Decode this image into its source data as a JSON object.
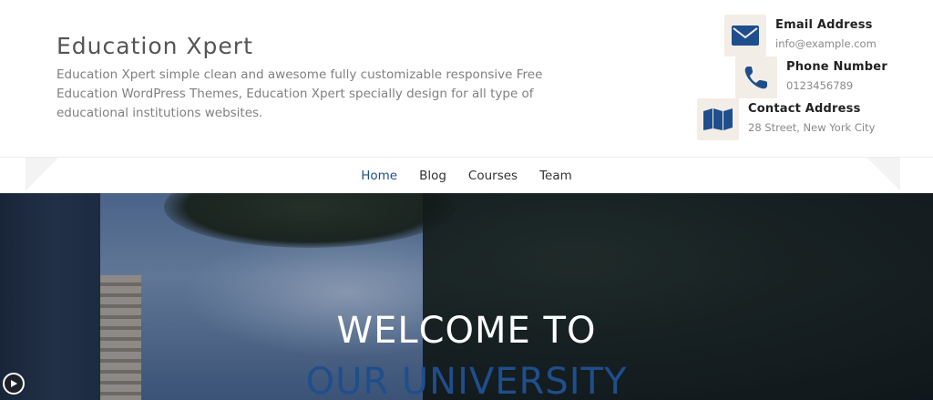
{
  "site": {
    "title": "Education Xpert",
    "description": "Education Xpert simple clean and awesome fully customizable responsive Free Education WordPress Themes, Education Xpert specially design for all type of educational institutions websites."
  },
  "contacts": [
    {
      "label": "Email Address",
      "value": "info@example.com",
      "icon": "envelope-icon"
    },
    {
      "label": "Phone Number",
      "value": "0123456789",
      "icon": "phone-icon"
    },
    {
      "label": "Contact Address",
      "value": "28 Street, New York City",
      "icon": "map-icon"
    }
  ],
  "nav": {
    "items": [
      {
        "label": "Home",
        "active": true
      },
      {
        "label": "Blog",
        "active": false
      },
      {
        "label": "Courses",
        "active": false
      },
      {
        "label": "Team",
        "active": false
      }
    ]
  },
  "hero": {
    "title": "WELCOME TO",
    "subtitle": "OUR UNIVERSITY"
  },
  "colors": {
    "accent": "#1f4e8c",
    "icon_bg": "#f3ede7"
  }
}
